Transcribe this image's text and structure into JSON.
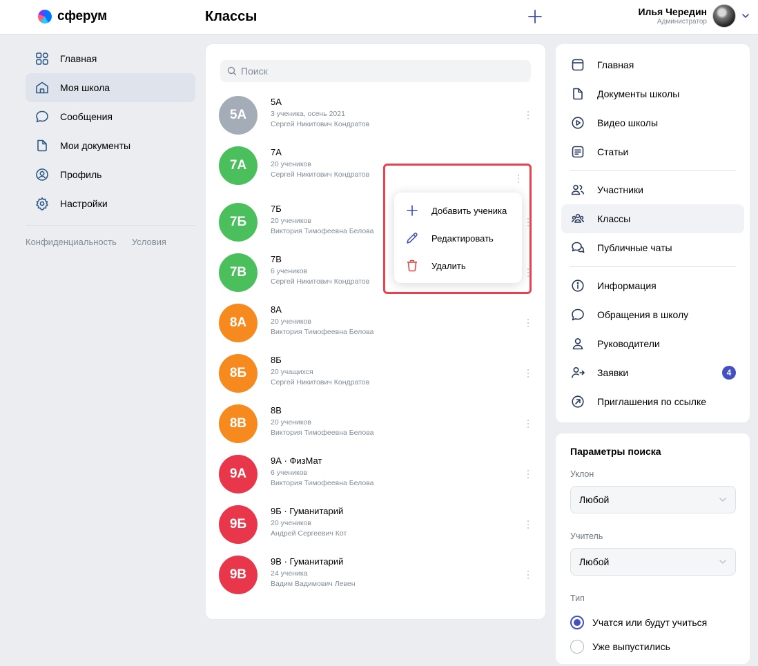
{
  "app": {
    "logo_text": "сферум",
    "page_title": "Классы",
    "user": {
      "name": "Илья Чередин",
      "role": "Администратор"
    }
  },
  "left_nav": {
    "items": [
      {
        "label": "Главная",
        "icon": "home-grid-icon",
        "active": false
      },
      {
        "label": "Моя школа",
        "icon": "school-icon",
        "active": true
      },
      {
        "label": "Сообщения",
        "icon": "message-icon",
        "active": false
      },
      {
        "label": "Мои документы",
        "icon": "document-icon",
        "active": false
      },
      {
        "label": "Профиль",
        "icon": "profile-icon",
        "active": false
      },
      {
        "label": "Настройки",
        "icon": "settings-icon",
        "active": false
      }
    ],
    "footer_links": [
      "Конфиденциальность",
      "Условия"
    ]
  },
  "search": {
    "placeholder": "Поиск"
  },
  "classes": [
    {
      "badge": "5А",
      "name": "5А",
      "meta": "3 ученика, осень 2021",
      "teacher": "Сергей Никитович Кондратов",
      "color": "#a4acb8"
    },
    {
      "badge": "7А",
      "name": "7А",
      "meta": "20 учеников",
      "teacher": "Сергей Никитович Кондратов",
      "color": "#4bbf5c"
    },
    {
      "badge": "7Б",
      "name": "7Б",
      "meta": "20 учеников",
      "teacher": "Виктория Тимофеевна Белова",
      "color": "#4bbf5c"
    },
    {
      "badge": "7В",
      "name": "7В",
      "meta": "6 учеников",
      "teacher": "Сергей Никитович Кондратов",
      "color": "#4bbf5c"
    },
    {
      "badge": "8А",
      "name": "8А",
      "meta": "20 учеников",
      "teacher": "Виктория Тимофеевна Белова",
      "color": "#f68a1e"
    },
    {
      "badge": "8Б",
      "name": "8Б",
      "meta": "20 учащихся",
      "teacher": "Сергей Никитович Кондратов",
      "color": "#f68a1e"
    },
    {
      "badge": "8В",
      "name": "8В",
      "meta": "20 учеников",
      "teacher": "Виктория Тимофеевна Белова",
      "color": "#f68a1e"
    },
    {
      "badge": "9А",
      "name": "9А · ФизМат",
      "meta": "6 учеников",
      "teacher": "Виктория Тимофеевна Белова",
      "color": "#e8374a"
    },
    {
      "badge": "9Б",
      "name": "9Б · Гуманитарий",
      "meta": "20 учеников",
      "teacher": "Андрей Сергеевич Кот",
      "color": "#e8374a"
    },
    {
      "badge": "9В",
      "name": "9В · Гуманитарий",
      "meta": "24 ученика",
      "teacher": "Вадим Вадимович Левен",
      "color": "#e8374a"
    }
  ],
  "context_menu": {
    "items": [
      {
        "label": "Добавить ученика",
        "icon": "plus-icon"
      },
      {
        "label": "Редактировать",
        "icon": "pencil-icon"
      },
      {
        "label": "Удалить",
        "icon": "trash-icon"
      }
    ]
  },
  "right_nav": {
    "group1": [
      {
        "label": "Главная",
        "icon": "window-icon"
      },
      {
        "label": "Документы школы",
        "icon": "document-icon"
      },
      {
        "label": "Видео школы",
        "icon": "play-icon"
      },
      {
        "label": "Статьи",
        "icon": "article-icon"
      }
    ],
    "group2": [
      {
        "label": "Участники",
        "icon": "users-icon"
      },
      {
        "label": "Классы",
        "icon": "classes-icon",
        "active": true
      },
      {
        "label": "Публичные чаты",
        "icon": "chats-icon"
      }
    ],
    "group3": [
      {
        "label": "Информация",
        "icon": "info-icon"
      },
      {
        "label": "Обращения в школу",
        "icon": "message-icon"
      },
      {
        "label": "Руководители",
        "icon": "user-icon"
      },
      {
        "label": "Заявки",
        "icon": "user-arrow-icon",
        "badge": "4"
      },
      {
        "label": "Приглашения по ссылке",
        "icon": "link-arrow-icon"
      }
    ]
  },
  "filters": {
    "title": "Параметры поиска",
    "slant_label": "Уклон",
    "slant_value": "Любой",
    "teacher_label": "Учитель",
    "teacher_value": "Любой",
    "type_label": "Тип",
    "type_options": [
      {
        "label": "Учатся или будут учиться",
        "selected": true
      },
      {
        "label": "Уже выпустились",
        "selected": false
      }
    ]
  },
  "colors": {
    "accent": "#4350c0",
    "highlight": "#e8424c"
  }
}
